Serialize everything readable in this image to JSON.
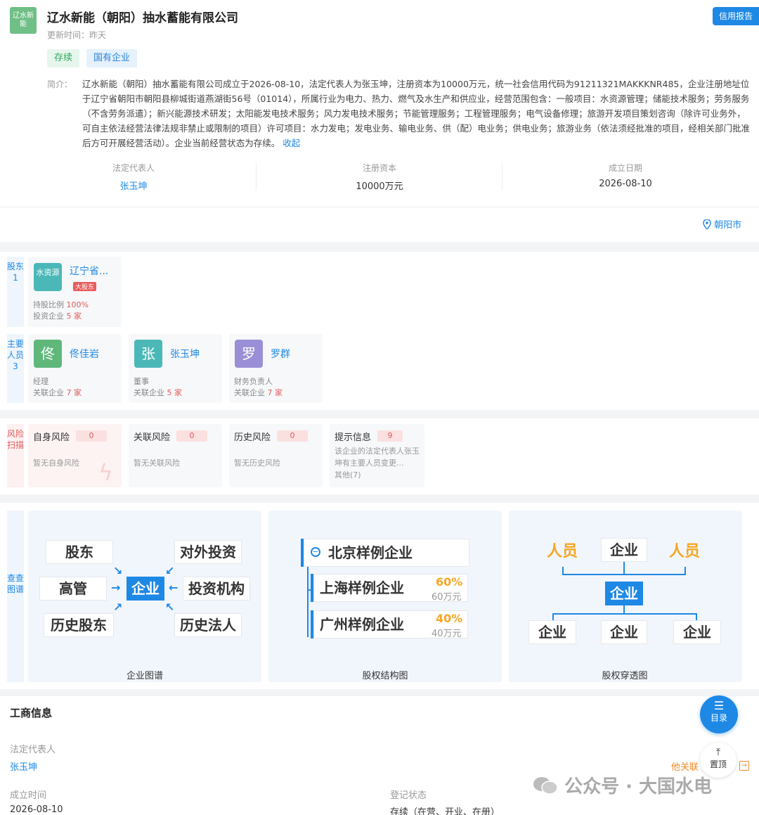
{
  "header": {
    "logo_text": "辽水新能",
    "company_name": "辽水新能（朝阳）抽水蓄能有限公司",
    "update_time": "更新时间：昨天",
    "report_button": "信用报告",
    "tags": [
      "存续",
      "国有企业"
    ],
    "intro_label": "简介：",
    "intro_text": "辽水新能（朝阳）抽水蓄能有限公司成立于2026-08-10，法定代表人为张玉坤，注册资本为10000万元，统一社会信用代码为91211321MAKKKNR485，企业注册地址位于辽宁省朝阳市朝阳县柳城街道燕湖街56号（01014），所属行业为电力、热力、燃气及水生产和供应业，经营范围包含：一般项目：水资源管理；储能技术服务；劳务服务（不含劳务派遣）；新兴能源技术研发；太阳能发电技术服务；风力发电技术服务；节能管理服务；工程管理服务；电气设备修理；旅游开发项目策划咨询（除许可业务外，可自主依法经营法律法规非禁止或限制的项目）许可项目：水力发电；发电业务、输电业务、供（配）电业务；供电业务；旅游业务（依法须经批准的项目，经相关部门批准后方可开展经营活动）。企业当前经营状态为存续。",
    "collapse_label": "收起",
    "location": "朝阳市"
  },
  "stats": [
    {
      "label": "法定代表人",
      "value": "张玉坤"
    },
    {
      "label": "注册资本",
      "value": "10000万元"
    },
    {
      "label": "成立日期",
      "value": "2026-08-10"
    }
  ],
  "shareholders": {
    "side_label": "股东1",
    "items": [
      {
        "avatar": "水资源",
        "name": "辽宁省...",
        "badge": "大股东",
        "ratio_label": "持股比例",
        "ratio": "100%",
        "invest_label": "投资企业",
        "invest_count": "5",
        "unit": "家"
      }
    ]
  },
  "people": {
    "side_label": "主要人员3",
    "items": [
      {
        "avatar": "佟",
        "name": "佟佳岩",
        "role": "经理",
        "related_label": "关联企业",
        "count": "7",
        "unit": "家",
        "color": "#5fb87a"
      },
      {
        "avatar": "张",
        "name": "张玉坤",
        "role": "董事",
        "related_label": "关联企业",
        "count": "5",
        "unit": "家",
        "color": "#4bb8b8"
      },
      {
        "avatar": "罗",
        "name": "罗群",
        "role": "财务负责人",
        "related_label": "关联企业",
        "count": "7",
        "unit": "家",
        "color": "#9a8fd6"
      }
    ]
  },
  "risk": {
    "side_label": "风险扫描",
    "items": [
      {
        "title": "自身风险",
        "count": "0",
        "desc": "暂无自身风险"
      },
      {
        "title": "关联风险",
        "count": "0",
        "desc": "暂无关联风险"
      },
      {
        "title": "历史风险",
        "count": "0",
        "desc": "暂无历史风险"
      },
      {
        "title": "提示信息",
        "count": "9",
        "desc": "该企业的法定代表人张玉坤有主要人员变更...",
        "extra": "其他(7)"
      }
    ]
  },
  "graphs": {
    "side_label": "查查图谱",
    "panel1": {
      "caption": "企业图谱",
      "center": "企业",
      "nodes": [
        "股东",
        "对外投资",
        "高管",
        "投资机构",
        "历史股东",
        "历史法人"
      ]
    },
    "panel2": {
      "caption": "股权结构图",
      "root": "北京样例企业",
      "children": [
        {
          "name": "上海样例企业",
          "percent": "60%",
          "amount": "60万元"
        },
        {
          "name": "广州样例企业",
          "percent": "40%",
          "amount": "40万元"
        }
      ]
    },
    "panel3": {
      "caption": "股权穿透图",
      "top": [
        "人员",
        "企业",
        "人员"
      ],
      "center": "企业",
      "bottom": [
        "企业",
        "企业",
        "企业"
      ]
    }
  },
  "business": {
    "title": "工商信息",
    "legal_rep_label": "法定代表人",
    "legal_rep_value": "张玉坤",
    "related_label": "他关联",
    "established_label": "成立时间",
    "established_value": "2026-08-10",
    "status_label": "登记状态",
    "status_value": "存续（在营、开业、在册）"
  },
  "fab": {
    "label": "目录",
    "top_label": "置顶"
  },
  "watermark": "公众号 · 大国水电",
  "colors": {
    "accent": "#1e88e5",
    "green": "#2eaa5c",
    "red": "#e05b5b"
  }
}
